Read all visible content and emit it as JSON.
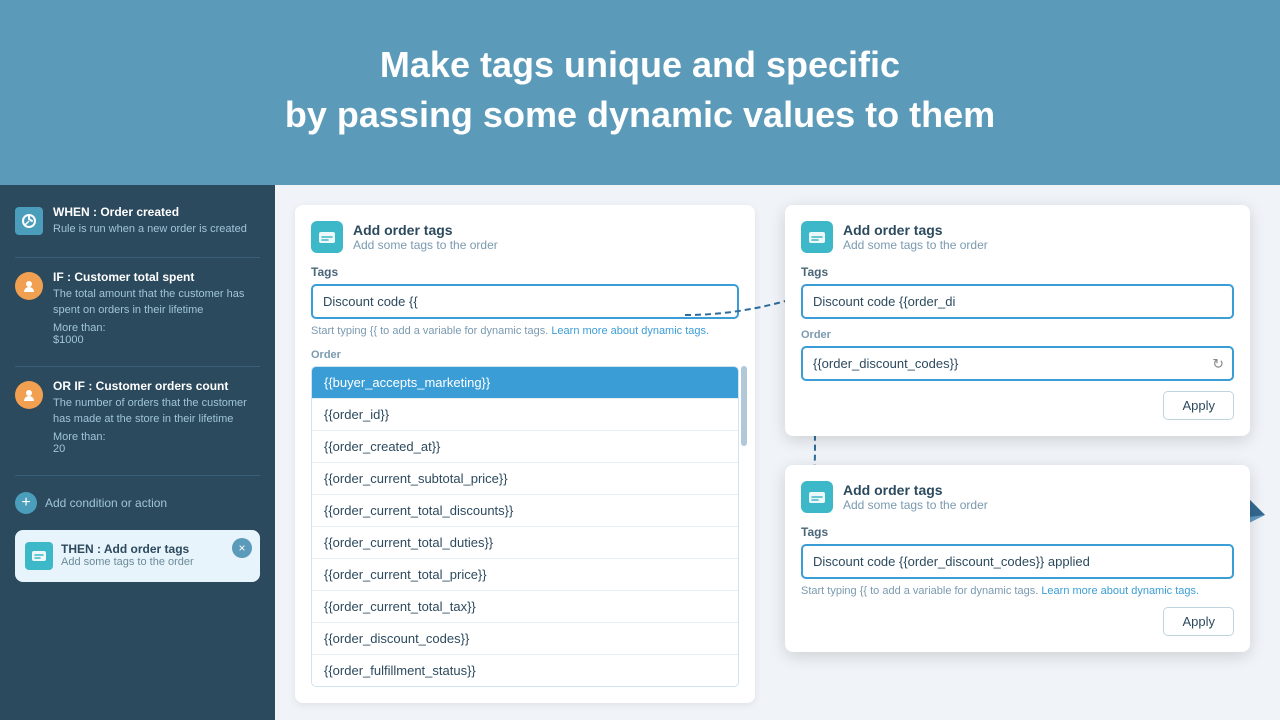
{
  "hero": {
    "line1": "Make tags unique and specific",
    "line2": "by passing some dynamic values to them"
  },
  "sidebar": {
    "when": {
      "label": "WHEN : Order created",
      "desc": "Rule is run when a new order is created"
    },
    "if1": {
      "label": "IF : Customer total spent",
      "desc": "The total amount that the customer has spent on orders in their lifetime",
      "more_label": "More than:",
      "more_value": "$1000"
    },
    "or_if": {
      "label": "OR IF : Customer orders count",
      "desc": "The number of orders that the customer has made at the store in their lifetime",
      "more_label": "More than:",
      "more_value": "20"
    },
    "add_condition": "Add condition or action",
    "then": {
      "label": "THEN : Add order tags",
      "desc": "Add some tags to the order"
    }
  },
  "main_card": {
    "title": "Add order tags",
    "subtitle": "Add some tags to the order",
    "tags_label": "Tags",
    "tags_value": "Discount code {{",
    "hint": "Start typing {{ to add a variable for dynamic tags.",
    "hint_link": "Learn more about dynamic tags.",
    "order_label": "Order",
    "dropdown_items": [
      "{{buyer_accepts_marketing}}",
      "{{order_id}}",
      "{{order_created_at}}",
      "{{order_current_subtotal_price}}",
      "{{order_current_total_discounts}}",
      "{{order_current_total_duties}}",
      "{{order_current_total_price}}",
      "{{order_current_total_tax}}",
      "{{order_discount_codes}}",
      "{{order_fulfillment_status}}"
    ]
  },
  "overlay1": {
    "title": "Add order tags",
    "subtitle": "Add some tags to the order",
    "tags_label": "Tags",
    "tags_value": "Discount code {{order_di",
    "order_label": "Order",
    "order_var": "{{order_discount_codes}}",
    "apply_label": "Apply"
  },
  "overlay2": {
    "title": "Add order tags",
    "subtitle": "Add some tags to the order",
    "tags_label": "Tags",
    "tags_value": "Discount code {{order_discount_codes}} applied",
    "hint": "Start typing {{ to add a variable for dynamic tags.",
    "hint_link": "Learn more about dynamic tags.",
    "apply_label": "Apply"
  }
}
